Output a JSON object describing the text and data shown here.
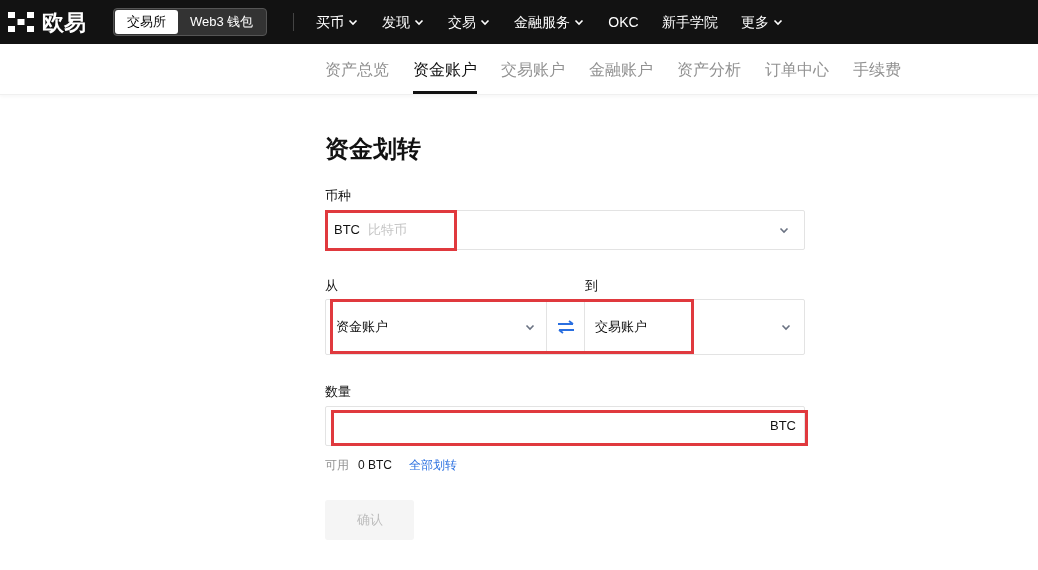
{
  "header": {
    "logo": "欧易",
    "mode_switch": [
      {
        "label": "交易所",
        "selected": true
      },
      {
        "label": "Web3 钱包",
        "selected": false
      }
    ],
    "nav": [
      {
        "label": "买币",
        "has_menu": true
      },
      {
        "label": "发现",
        "has_menu": true
      },
      {
        "label": "交易",
        "has_menu": true
      },
      {
        "label": "金融服务",
        "has_menu": true
      },
      {
        "label": "OKC",
        "has_menu": false
      },
      {
        "label": "新手学院",
        "has_menu": false
      },
      {
        "label": "更多",
        "has_menu": true
      }
    ]
  },
  "subnav": [
    {
      "label": "资产总览",
      "selected": false
    },
    {
      "label": "资金账户",
      "selected": true
    },
    {
      "label": "交易账户",
      "selected": false
    },
    {
      "label": "金融账户",
      "selected": false
    },
    {
      "label": "资产分析",
      "selected": false
    },
    {
      "label": "订单中心",
      "selected": false
    },
    {
      "label": "手续费",
      "selected": false
    }
  ],
  "form": {
    "title": "资金划转",
    "coin": {
      "label": "币种",
      "value": "BTC",
      "name": "比特币",
      "highlighted": true
    },
    "from": {
      "label": "从",
      "value": "资金账户"
    },
    "to": {
      "label": "到",
      "value": "交易账户"
    },
    "accounts_highlighted": true,
    "amount": {
      "label": "数量",
      "unit": "BTC",
      "highlighted": true
    },
    "available": {
      "label": "可用",
      "value": "0 BTC",
      "link": "全部划转"
    },
    "confirm": {
      "label": "确认",
      "disabled": true
    }
  }
}
